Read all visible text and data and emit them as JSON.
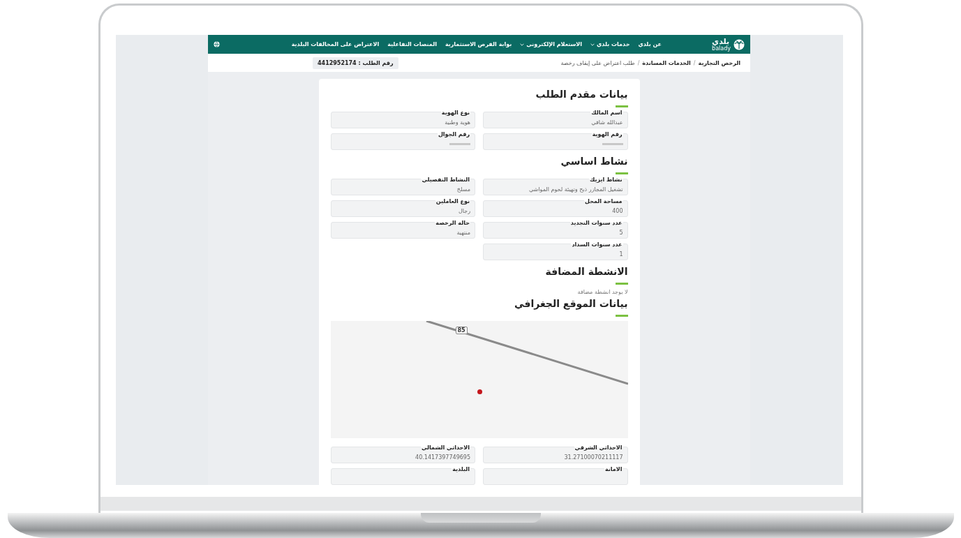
{
  "logo": {
    "arabic": "بلدي",
    "latin": "balady"
  },
  "nav": {
    "items": [
      {
        "label": "عن بلدي",
        "dropdown": false
      },
      {
        "label": "خدمات بلدي",
        "dropdown": true
      },
      {
        "label": "الاستعلام الإلكتروني",
        "dropdown": true
      },
      {
        "label": "بوابة الفرص الاستثمارية",
        "dropdown": false
      },
      {
        "label": "المنصات التفاعلية",
        "dropdown": false
      },
      {
        "label": "الاعتراض على المخالفات البلدية",
        "dropdown": false
      }
    ]
  },
  "breadcrumb_separator": "/",
  "breadcrumb": [
    "الرخص التجارية",
    "الخدمات المساندة",
    "طلب اعتراض على إيقاف رخصة"
  ],
  "request_number": "رقم الطلب : 4412952174",
  "sections": [
    {
      "title": "بيانات مقدم الطلب",
      "fields": [
        {
          "label": "اسم المالك",
          "value": "عبدالله شافي",
          "masked": false
        },
        {
          "label": "نوع الهوية",
          "value": "هوية وطنية",
          "masked": false
        },
        {
          "label": "رقم الهوية",
          "masked": true
        },
        {
          "label": "رقم الجوال",
          "masked": true
        }
      ]
    },
    {
      "title": "نشاط اساسي",
      "fields": [
        {
          "label": "نشاط ايزيك",
          "value": "تشغيل المجازر ذبح وتهيئة لحوم المواشي",
          "masked": false
        },
        {
          "label": "النشاط التفصيلي",
          "value": "مسلخ",
          "masked": false
        },
        {
          "label": "مساحة المحل",
          "value": "400",
          "masked": false
        },
        {
          "label": "نوع العاملين",
          "value": "رجال",
          "masked": false
        },
        {
          "label": "عدد سنوات التجديد",
          "value": "5",
          "masked": false
        },
        {
          "label": "حالة الرخصة",
          "value": "منتهية",
          "masked": false
        },
        {
          "label": "عدد سنوات السداد",
          "value": "1",
          "masked": false
        }
      ]
    },
    {
      "title": "الانشطة المضافة",
      "note": "لا يوجد انشطة مضافة"
    },
    {
      "title": "بيانات الموقع الجغرافي",
      "map": {
        "road_label": "85"
      },
      "fields": [
        {
          "label": "الاحداثي الشرقي",
          "value": "31.27100070211117",
          "masked": false
        },
        {
          "label": "الاحداثي الشمالي",
          "value": "40.1417397749695",
          "masked": false
        },
        {
          "label": "الامانة",
          "masked": false
        },
        {
          "label": "البلدية",
          "masked": false
        }
      ]
    }
  ]
}
